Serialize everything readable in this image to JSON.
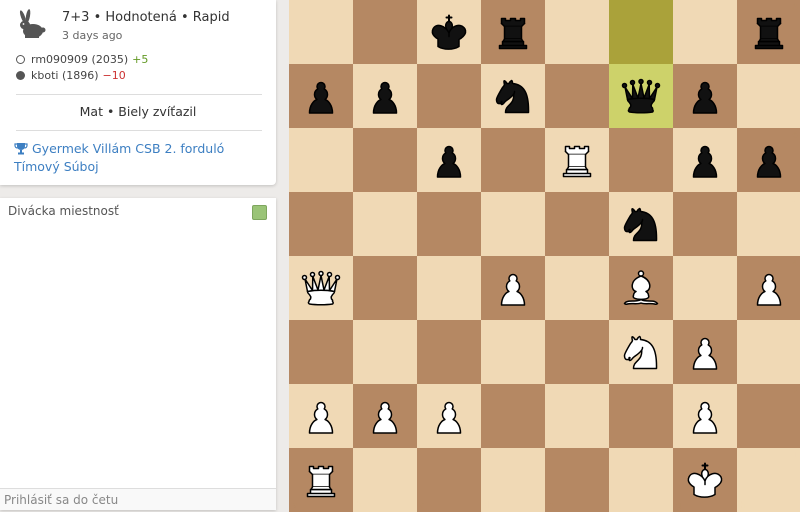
{
  "game": {
    "mode": "7+3 • Hodnotená • Rapid",
    "time_ago": "3 days ago",
    "players": [
      {
        "color": "white",
        "name": "rm090909 (2035)",
        "diff": "+5"
      },
      {
        "color": "black",
        "name": "kboti (1896)",
        "diff": "−10"
      }
    ],
    "result": "Mat • Biely zvíťazil",
    "tournament": "Gyermek Villám CSB 2. forduló Tímový Súboj",
    "icon": "rabbit-icon"
  },
  "chat": {
    "title": "Divácka miestnosť",
    "input_placeholder": "Prihlásiť sa do četu",
    "toggle_color": "#9ac477"
  },
  "board": {
    "colors": {
      "light": "#f0d9b5",
      "dark": "#b58863",
      "last_move_from": "#aaa23a",
      "last_move_to": "#cdd26a"
    },
    "files": [
      "a",
      "b",
      "c",
      "d",
      "e",
      "f",
      "g",
      "h"
    ],
    "ranks": [
      "8",
      "7",
      "6",
      "5",
      "4",
      "3",
      "2",
      "1"
    ],
    "last_move": {
      "from": "f8",
      "to": "f7"
    },
    "pieces": [
      {
        "square": "c8",
        "type": "king",
        "color": "black"
      },
      {
        "square": "d8",
        "type": "rook",
        "color": "black"
      },
      {
        "square": "h8",
        "type": "rook",
        "color": "black"
      },
      {
        "square": "a7",
        "type": "pawn",
        "color": "black"
      },
      {
        "square": "b7",
        "type": "pawn",
        "color": "black"
      },
      {
        "square": "d7",
        "type": "knight",
        "color": "black"
      },
      {
        "square": "f7",
        "type": "queen",
        "color": "black"
      },
      {
        "square": "g7",
        "type": "pawn",
        "color": "black"
      },
      {
        "square": "c6",
        "type": "pawn",
        "color": "black"
      },
      {
        "square": "e6",
        "type": "rook",
        "color": "white"
      },
      {
        "square": "g6",
        "type": "pawn",
        "color": "black"
      },
      {
        "square": "h6",
        "type": "pawn",
        "color": "black"
      },
      {
        "square": "f5",
        "type": "knight",
        "color": "black"
      },
      {
        "square": "a4",
        "type": "queen",
        "color": "white"
      },
      {
        "square": "d4",
        "type": "pawn",
        "color": "white"
      },
      {
        "square": "f4",
        "type": "bishop",
        "color": "white"
      },
      {
        "square": "h4",
        "type": "pawn",
        "color": "white"
      },
      {
        "square": "f3",
        "type": "knight",
        "color": "white"
      },
      {
        "square": "g3",
        "type": "pawn",
        "color": "white"
      },
      {
        "square": "a2",
        "type": "pawn",
        "color": "white"
      },
      {
        "square": "b2",
        "type": "pawn",
        "color": "white"
      },
      {
        "square": "c2",
        "type": "pawn",
        "color": "white"
      },
      {
        "square": "g2",
        "type": "pawn",
        "color": "white"
      },
      {
        "square": "a1",
        "type": "rook",
        "color": "white"
      },
      {
        "square": "g1",
        "type": "king",
        "color": "white"
      }
    ]
  }
}
